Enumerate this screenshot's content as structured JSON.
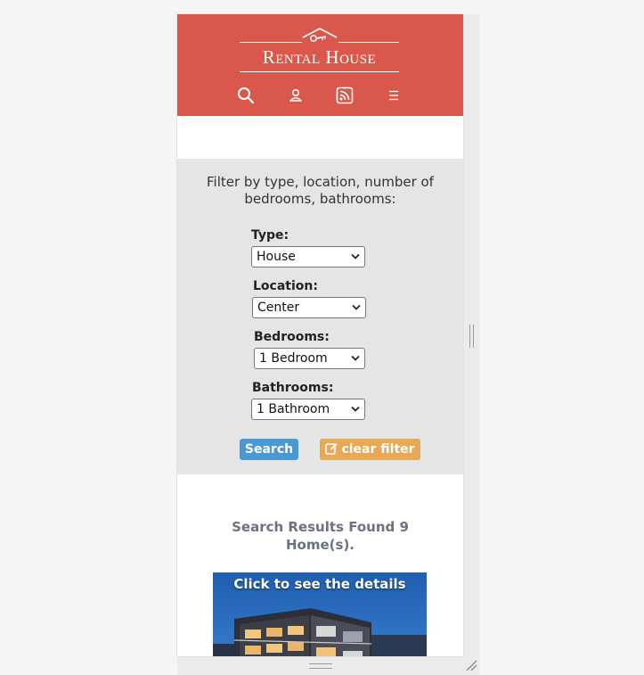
{
  "header": {
    "brand": "Rental House",
    "nav": [
      {
        "name": "search-icon"
      },
      {
        "name": "user-icon"
      },
      {
        "name": "rss-icon"
      },
      {
        "name": "menu-icon"
      }
    ],
    "color": "#d9584b"
  },
  "filter": {
    "heading": "Filter by type, location, number of bedrooms, bathrooms:",
    "fields": [
      {
        "label": "Type:",
        "value": "House"
      },
      {
        "label": "Location:",
        "value": "Center"
      },
      {
        "label": "Bedrooms:",
        "value": "1 Bedroom"
      },
      {
        "label": "Bathrooms:",
        "value": "1 Bathroom"
      }
    ],
    "search_label": "Search",
    "clear_label": "clear filter",
    "search_color": "#4a98d4",
    "clear_color": "#e8a855"
  },
  "results": {
    "text": "Search Results Found 9 Home(s)."
  },
  "card": {
    "caption": "Click to see the details"
  }
}
